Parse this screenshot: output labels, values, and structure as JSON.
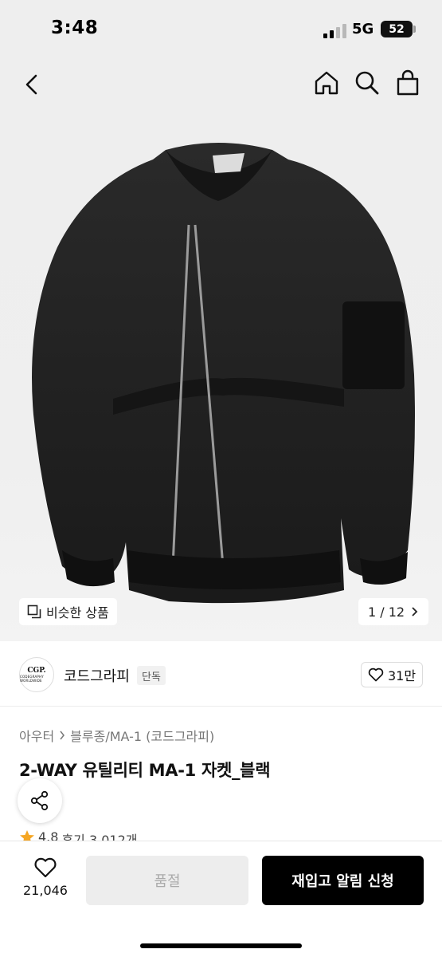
{
  "status_bar": {
    "time": "3:48",
    "network": "5G",
    "battery": "52"
  },
  "nav": {
    "back": "back-icon",
    "home": "home-icon",
    "search": "search-icon",
    "bag": "shopping-bag-icon"
  },
  "gallery": {
    "similar_label": "비슷한 상품",
    "page": "1 / 12"
  },
  "brand": {
    "logo_line1": "CGP.",
    "logo_line2": "CODEGRAPHY WORLDWIDE",
    "name": "코드그라피",
    "badge": "단독",
    "likes": "31만"
  },
  "product": {
    "breadcrumb": [
      "아우터",
      "블루종/MA-1 (코드그라피)"
    ],
    "title": "2-WAY 유틸리티 MA-1 자켓_블랙",
    "rating": "4.8",
    "reviews": "후기 3,012개"
  },
  "bottom": {
    "wish_count": "21,046",
    "soldout_label": "품절",
    "restock_label": "재입고 알림 신청"
  },
  "colors": {
    "accent": "#000000",
    "star": "#f5a623",
    "disabled": "#ededed"
  }
}
